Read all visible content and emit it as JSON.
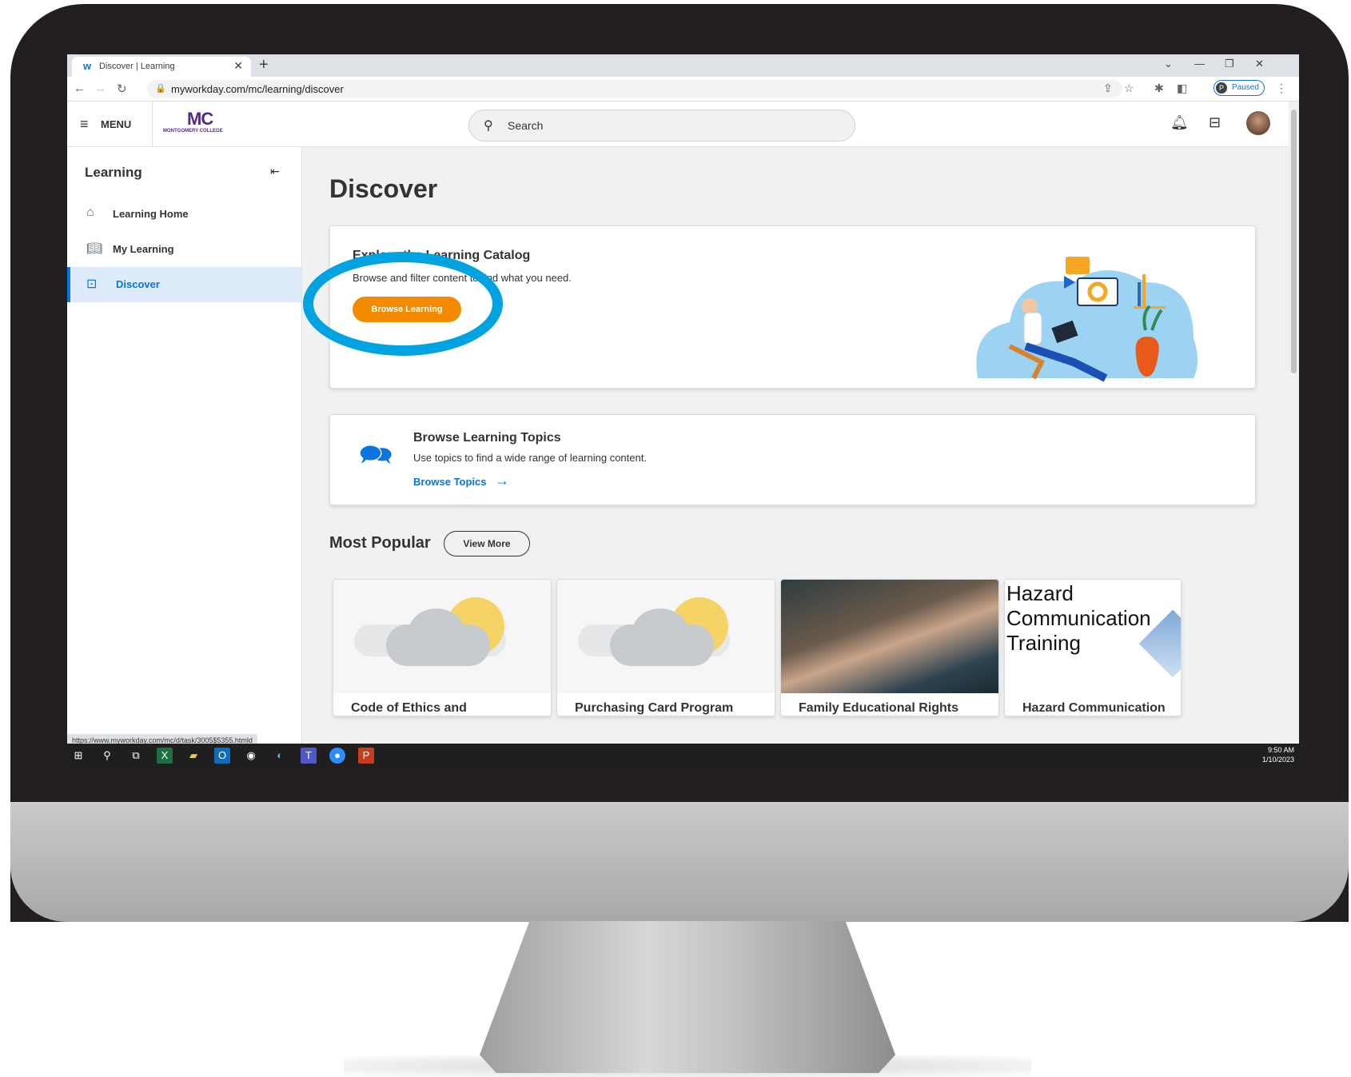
{
  "browser": {
    "tab_title": "Discover | Learning",
    "url": "myworkday.com/mc/learning/discover",
    "profile_initial": "P",
    "profile_status": "Paused",
    "status_url": "https://www.myworkday.com/mc/d/task/3005$5355.htmld"
  },
  "header": {
    "menu_label": "MENU",
    "logo_mark": "MC",
    "logo_subtext": "MONTGOMERY COLLEGE",
    "search_placeholder": "Search"
  },
  "sidebar": {
    "title": "Learning",
    "items": [
      {
        "label": "Learning Home",
        "icon": "home-icon"
      },
      {
        "label": "My Learning",
        "icon": "book-icon"
      },
      {
        "label": "Discover",
        "icon": "discover-icon",
        "active": true
      }
    ]
  },
  "main": {
    "page_title": "Discover",
    "explore": {
      "title": "Explore the Learning Catalog",
      "description": "Browse and filter content to find what you need.",
      "button_label": "Browse Learning"
    },
    "topics": {
      "title": "Browse Learning Topics",
      "description": "Use topics to find a wide range of learning content.",
      "link_label": "Browse Topics"
    },
    "popular": {
      "title": "Most Popular",
      "view_more": "View More",
      "courses": [
        {
          "title": "Code of Ethics and",
          "thumb": "cloud-sun-placeholder"
        },
        {
          "title": "Purchasing Card Program",
          "thumb": "cloud-sun-placeholder"
        },
        {
          "title": "Family Educational Rights",
          "thumb": "classroom-photo"
        },
        {
          "title": "Hazard Communication",
          "thumb_text": "Hazard Communication Training"
        }
      ]
    }
  },
  "taskbar": {
    "time": "9:50 AM",
    "date": "1/10/2023"
  },
  "colors": {
    "accent_blue": "#0875e1",
    "orange_button": "#f38b00",
    "highlight_oval": "#00a3e0",
    "brand_purple": "#512b85"
  }
}
